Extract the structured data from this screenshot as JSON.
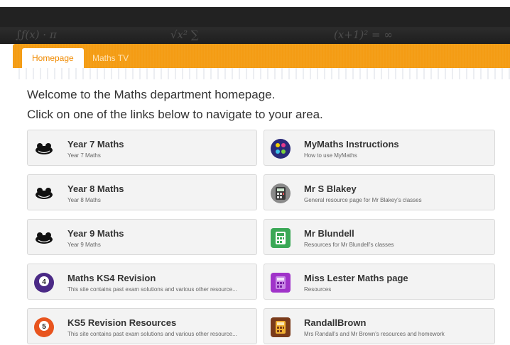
{
  "tabs": [
    {
      "label": "Homepage",
      "active": true
    },
    {
      "label": "Maths TV",
      "active": false
    }
  ],
  "welcome": "Welcome to the Maths department homepage.",
  "instructions": "Click on one of the links below to navigate to your area.",
  "colors": {
    "accent": "#f39a12",
    "banner": "#222222",
    "card_bg": "#f3f3f3"
  },
  "cards": [
    {
      "title": "Year 7 Maths",
      "subtitle": "Year 7 Maths",
      "icon": "frog-icon"
    },
    {
      "title": "MyMaths Instructions",
      "subtitle": "How to use MyMaths",
      "icon": "mymaths-logo-icon"
    },
    {
      "title": "Year 8 Maths",
      "subtitle": "Year 8 Maths",
      "icon": "frog-icon"
    },
    {
      "title": "Mr S Blakey",
      "subtitle": "General resource page for Mr Blakey's classes",
      "icon": "calculator-icon"
    },
    {
      "title": "Year 9 Maths",
      "subtitle": "Year 9 Maths",
      "icon": "frog-icon"
    },
    {
      "title": "Mr Blundell",
      "subtitle": "Resources for Mr Blundell's classes",
      "icon": "calculator-icon"
    },
    {
      "title": "Maths KS4 Revision",
      "subtitle": "This site contains past exam solutions and various other resource...",
      "icon": "ball-4-icon"
    },
    {
      "title": "Miss Lester Maths page",
      "subtitle": "Resources",
      "icon": "calculator-icon"
    },
    {
      "title": "KS5 Revision Resources",
      "subtitle": "This site contains past exam solutions and various other resource...",
      "icon": "ball-5-icon"
    },
    {
      "title": "RandallBrown",
      "subtitle": "Mrs Randall's and Mr Brown's resources and homework",
      "icon": "calculator-icon"
    }
  ]
}
